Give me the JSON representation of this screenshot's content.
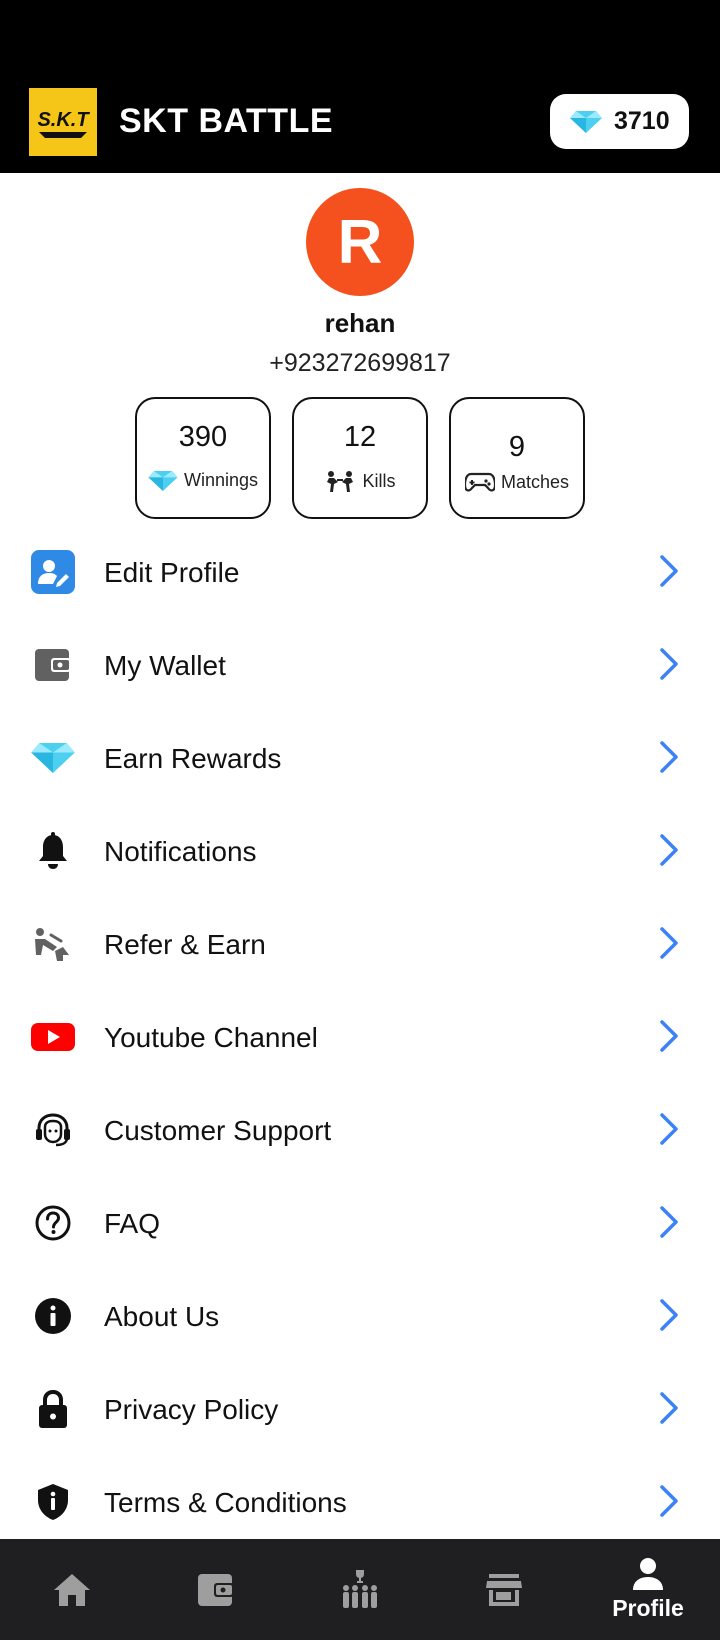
{
  "header": {
    "logo_text": "S.K.T",
    "title": "SKT BATTLE",
    "coins": "3710"
  },
  "profile": {
    "avatar_initial": "R",
    "name": "rehan",
    "phone": "+923272699817"
  },
  "stats": [
    {
      "value": "390",
      "label": "Winnings",
      "icon": "diamond-icon"
    },
    {
      "value": "12",
      "label": "Kills",
      "icon": "fighters-icon"
    },
    {
      "value": "9",
      "label": "Matches",
      "icon": "gamepad-icon"
    }
  ],
  "menu": [
    {
      "label": "Edit Profile",
      "icon": "edit-profile-icon"
    },
    {
      "label": "My Wallet",
      "icon": "wallet-icon"
    },
    {
      "label": "Earn Rewards",
      "icon": "diamond-icon"
    },
    {
      "label": "Notifications",
      "icon": "bell-icon"
    },
    {
      "label": "Refer & Earn",
      "icon": "refer-icon"
    },
    {
      "label": "Youtube Channel",
      "icon": "youtube-icon"
    },
    {
      "label": "Customer Support",
      "icon": "headset-icon"
    },
    {
      "label": "FAQ",
      "icon": "question-icon"
    },
    {
      "label": "About Us",
      "icon": "info-icon"
    },
    {
      "label": "Privacy Policy",
      "icon": "lock-icon"
    },
    {
      "label": "Terms & Conditions",
      "icon": "shield-icon"
    }
  ],
  "bottom_nav": [
    {
      "icon": "home-icon",
      "label": ""
    },
    {
      "icon": "wallet-icon",
      "label": ""
    },
    {
      "icon": "leaderboard-icon",
      "label": ""
    },
    {
      "icon": "store-icon",
      "label": ""
    },
    {
      "icon": "person-icon",
      "label": "Profile",
      "active": true
    }
  ],
  "colors": {
    "header_bg": "#000000",
    "accent_blue": "#3b82f6",
    "avatar_bg": "#f4511e",
    "logo_bg": "#f5c518",
    "nav_bg": "#1f1f21",
    "nav_inactive": "#9e9e9e"
  }
}
